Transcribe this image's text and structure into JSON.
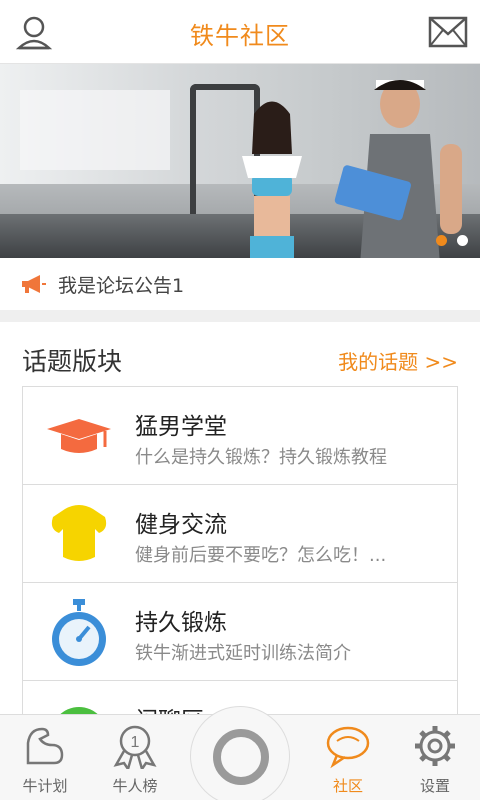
{
  "header": {
    "title": "铁牛社区",
    "left_icon": "user-icon",
    "right_icon": "mail-icon"
  },
  "banner": {
    "slides": 2,
    "active_slide": 1
  },
  "notice": {
    "icon": "megaphone-icon",
    "text": "我是论坛公告1"
  },
  "topics": {
    "title": "话题版块",
    "my_topics_link": "我的话题 >>",
    "items": [
      {
        "title": "猛男学堂",
        "desc": "什么是持久锻炼？持久锻炼教程",
        "icon": "graduation-cap-icon"
      },
      {
        "title": "健身交流",
        "desc": "健身前后要不要吃？怎么吃！...",
        "icon": "muscle-torso-icon"
      },
      {
        "title": "持久锻炼",
        "desc": "铁牛渐进式延时训练法简介",
        "icon": "stopwatch-icon"
      },
      {
        "title": "闲聊区",
        "desc": "",
        "icon": "chat-icon"
      }
    ]
  },
  "tabbar": {
    "tabs": [
      {
        "label": "牛计划",
        "icon": "arm-icon"
      },
      {
        "label": "牛人榜",
        "icon": "medal-icon",
        "badge": "1"
      },
      {
        "label": "社区",
        "icon": "speech-bubble-icon"
      },
      {
        "label": "设置",
        "icon": "gear-icon"
      }
    ],
    "active": "社区",
    "center_icon": "ring-button-icon"
  },
  "colors": {
    "accent": "#f08a1c",
    "text_primary": "#222222",
    "text_secondary": "#8a8a8a"
  }
}
